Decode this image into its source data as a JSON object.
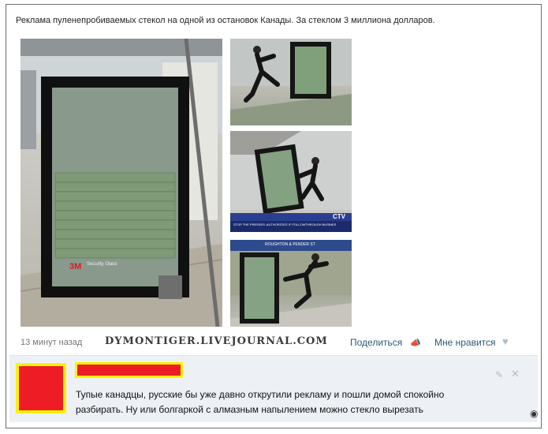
{
  "post": {
    "text": "Реклама пуленепробиваемых стекол на одной из остановок Канады. За стеклом 3 миллиона долларов."
  },
  "photos": {
    "main_brand": "3M",
    "main_product": "Security Glass",
    "b_ticker": "STOP THE PRESSES: AUTHORITIES IF FOLLOWTHROUGH BUSINESS HAS...",
    "b_channel": "CTV",
    "c_street": "ROUGHTON & PENDER ST"
  },
  "meta": {
    "time": "13 минут назад",
    "watermark": "DYMONTIGER.LIVEJOURNAL.COM",
    "share_label": "Поделиться",
    "like_label": "Мне нравится"
  },
  "comment": {
    "text": "Тупые канадцы, русские бы уже давно открутили рекламу и пошли домой спокойно разбирать. Ну или болгаркой с алмазным напылением можно стекло вырезать"
  },
  "colors": {
    "link": "#2b587a",
    "comment_bg": "#edf1f5",
    "censor_red": "#ee1c24",
    "censor_yellow": "#fff200"
  },
  "icons": {
    "share": "megaphone-icon",
    "like": "heart-icon",
    "edit": "pencil-icon",
    "delete": "close-icon",
    "watermark_mark": "eye-icon"
  }
}
